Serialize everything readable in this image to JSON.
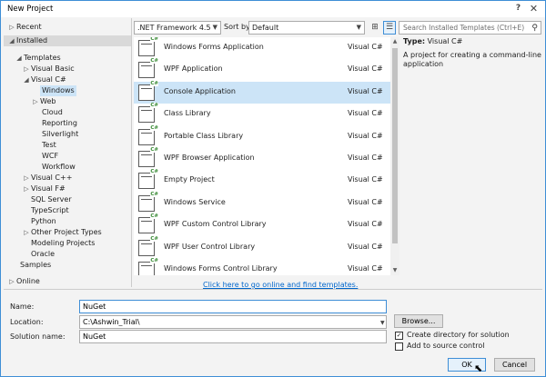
{
  "window": {
    "title": "New Project"
  },
  "tree": {
    "recent": "Recent",
    "installed": "Installed",
    "templates": "Templates",
    "visual_basic": "Visual Basic",
    "visual_csharp": "Visual C#",
    "windows": "Windows",
    "web": "Web",
    "cloud": "Cloud",
    "reporting": "Reporting",
    "silverlight": "Silverlight",
    "test": "Test",
    "wcf": "WCF",
    "workflow": "Workflow",
    "visual_cpp": "Visual C++",
    "visual_fsharp": "Visual F#",
    "sql_server": "SQL Server",
    "typescript": "TypeScript",
    "python": "Python",
    "other_project_types": "Other Project Types",
    "modeling_projects": "Modeling Projects",
    "oracle": "Oracle",
    "samples": "Samples",
    "online": "Online"
  },
  "toolbar": {
    "framework": ".NET Framework 4.5",
    "sort_label": "Sort by:",
    "sort_value": "Default",
    "search_placeholder": "Search Installed Templates (Ctrl+E)"
  },
  "templates": [
    {
      "name": "Windows Forms Application",
      "lang": "Visual C#"
    },
    {
      "name": "WPF Application",
      "lang": "Visual C#"
    },
    {
      "name": "Console Application",
      "lang": "Visual C#"
    },
    {
      "name": "Class Library",
      "lang": "Visual C#"
    },
    {
      "name": "Portable Class Library",
      "lang": "Visual C#"
    },
    {
      "name": "WPF Browser Application",
      "lang": "Visual C#"
    },
    {
      "name": "Empty Project",
      "lang": "Visual C#"
    },
    {
      "name": "Windows Service",
      "lang": "Visual C#"
    },
    {
      "name": "WPF Custom Control Library",
      "lang": "Visual C#"
    },
    {
      "name": "WPF User Control Library",
      "lang": "Visual C#"
    },
    {
      "name": "Windows Forms Control Library",
      "lang": "Visual C#"
    }
  ],
  "icon_badge": "C#",
  "online_link": "Click here to go online and find templates.",
  "details": {
    "type_label": "Type:",
    "type_value": "Visual C#",
    "description": "A project for creating a command-line application"
  },
  "form": {
    "name_label": "Name:",
    "name_value": "NuGet",
    "location_label": "Location:",
    "location_value": "C:\\Ashwin_Trial\\",
    "solution_label": "Solution name:",
    "solution_value": "NuGet",
    "browse_label": "Browse...",
    "create_dir_label": "Create directory for solution",
    "add_source_label": "Add to source control",
    "ok_label": "OK",
    "cancel_label": "Cancel"
  },
  "selected_template_index": 2,
  "colors": {
    "accent": "#3e8ed6",
    "selection": "#cce4f7",
    "link": "#0066cc"
  }
}
